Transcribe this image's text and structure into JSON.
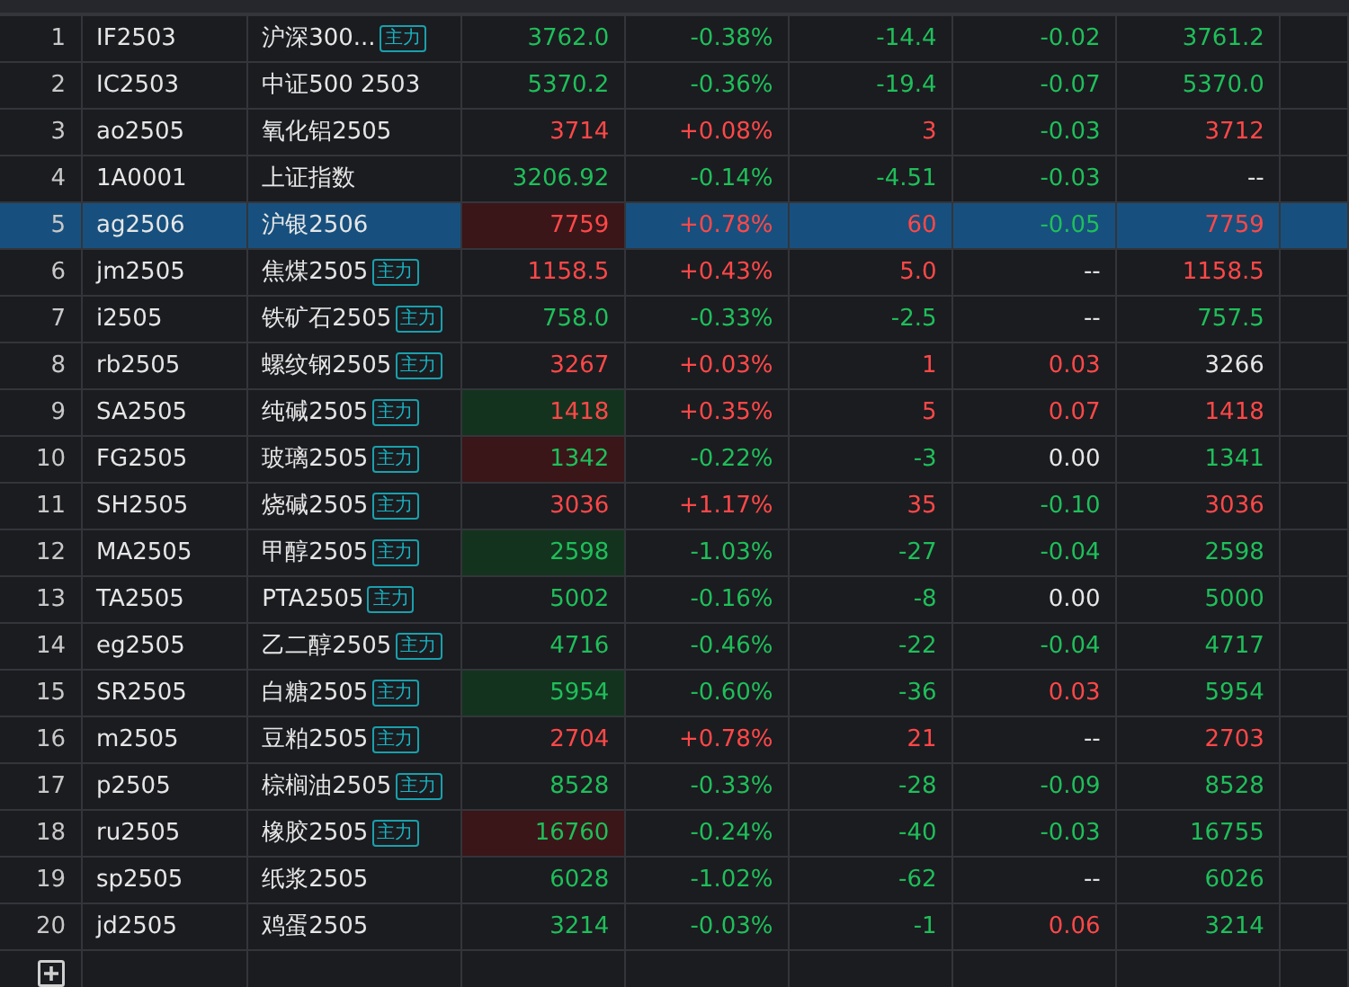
{
  "rows": [
    {
      "index": "1",
      "code": "IF2503",
      "name": "沪深300...",
      "tag": "主力",
      "selected": false,
      "cells": [
        {
          "text": "3762.0",
          "color": "#1fbf5a"
        },
        {
          "text": "-0.38%",
          "color": "#1fbf5a"
        },
        {
          "text": "-14.4",
          "color": "#1fbf5a"
        },
        {
          "text": "-0.02",
          "color": "#1fbf5a"
        },
        {
          "text": "3761.2",
          "color": "#1fbf5a"
        }
      ]
    },
    {
      "index": "2",
      "code": "IC2503",
      "name": "中证500 2503",
      "selected": false,
      "cells": [
        {
          "text": "5370.2",
          "color": "#1fbf5a"
        },
        {
          "text": "-0.36%",
          "color": "#1fbf5a"
        },
        {
          "text": "-19.4",
          "color": "#1fbf5a"
        },
        {
          "text": "-0.07",
          "color": "#1fbf5a"
        },
        {
          "text": "5370.0",
          "color": "#1fbf5a"
        }
      ]
    },
    {
      "index": "3",
      "code": "ao2505",
      "name": "氧化铝2505",
      "selected": false,
      "cells": [
        {
          "text": "3714",
          "color": "#ff4848"
        },
        {
          "text": "+0.08%",
          "color": "#ff4848"
        },
        {
          "text": "3",
          "color": "#ff4848"
        },
        {
          "text": "-0.03",
          "color": "#1fbf5a"
        },
        {
          "text": "3712",
          "color": "#ff4848"
        }
      ]
    },
    {
      "index": "4",
      "code": "1A0001",
      "name": "上证指数",
      "selected": false,
      "cells": [
        {
          "text": "3206.92",
          "color": "#1fbf5a"
        },
        {
          "text": "-0.14%",
          "color": "#1fbf5a"
        },
        {
          "text": "-4.51",
          "color": "#1fbf5a"
        },
        {
          "text": "-0.03",
          "color": "#1fbf5a"
        },
        {
          "text": "--",
          "color": "#e6e6e6"
        }
      ]
    },
    {
      "index": "5",
      "code": "ag2506",
      "name": "沪银2506",
      "selected": true,
      "highlight": {
        "color": "#3a1619"
      },
      "cells": [
        {
          "text": "7759",
          "color": "#ff4848"
        },
        {
          "text": "+0.78%",
          "color": "#ff4848"
        },
        {
          "text": "60",
          "color": "#ff4848"
        },
        {
          "text": "-0.05",
          "color": "#1fbf5a"
        },
        {
          "text": "7759",
          "color": "#ff4848"
        }
      ]
    },
    {
      "index": "6",
      "code": "jm2505",
      "name": "焦煤2505",
      "tag": "主力",
      "selected": false,
      "cells": [
        {
          "text": "1158.5",
          "color": "#ff4848"
        },
        {
          "text": "+0.43%",
          "color": "#ff4848"
        },
        {
          "text": "5.0",
          "color": "#ff4848"
        },
        {
          "text": "--",
          "color": "#e6e6e6"
        },
        {
          "text": "1158.5",
          "color": "#ff4848"
        }
      ]
    },
    {
      "index": "7",
      "code": "i2505",
      "name": "铁矿石2505",
      "tag": "主力",
      "selected": false,
      "cells": [
        {
          "text": "758.0",
          "color": "#1fbf5a"
        },
        {
          "text": "-0.33%",
          "color": "#1fbf5a"
        },
        {
          "text": "-2.5",
          "color": "#1fbf5a"
        },
        {
          "text": "--",
          "color": "#e6e6e6"
        },
        {
          "text": "757.5",
          "color": "#1fbf5a"
        }
      ]
    },
    {
      "index": "8",
      "code": "rb2505",
      "name": "螺纹钢2505",
      "tag": "主力",
      "selected": false,
      "cells": [
        {
          "text": "3267",
          "color": "#ff4848"
        },
        {
          "text": "+0.03%",
          "color": "#ff4848"
        },
        {
          "text": "1",
          "color": "#ff4848"
        },
        {
          "text": "0.03",
          "color": "#ff4848"
        },
        {
          "text": "3266",
          "color": "#e6e6e6"
        }
      ]
    },
    {
      "index": "9",
      "code": "SA2505",
      "name": "纯碱2505",
      "tag": "主力",
      "selected": false,
      "highlight": {
        "color": "#14331f"
      },
      "cells": [
        {
          "text": "1418",
          "color": "#ff4848"
        },
        {
          "text": "+0.35%",
          "color": "#ff4848"
        },
        {
          "text": "5",
          "color": "#ff4848"
        },
        {
          "text": "0.07",
          "color": "#ff4848"
        },
        {
          "text": "1418",
          "color": "#ff4848"
        }
      ]
    },
    {
      "index": "10",
      "code": "FG2505",
      "name": "玻璃2505",
      "tag": "主力",
      "selected": false,
      "highlight": {
        "color": "#3a1619"
      },
      "cells": [
        {
          "text": "1342",
          "color": "#1fbf5a"
        },
        {
          "text": "-0.22%",
          "color": "#1fbf5a"
        },
        {
          "text": "-3",
          "color": "#1fbf5a"
        },
        {
          "text": "0.00",
          "color": "#e6e6e6"
        },
        {
          "text": "1341",
          "color": "#1fbf5a"
        }
      ]
    },
    {
      "index": "11",
      "code": "SH2505",
      "name": "烧碱2505",
      "tag": "主力",
      "selected": false,
      "cells": [
        {
          "text": "3036",
          "color": "#ff4848"
        },
        {
          "text": "+1.17%",
          "color": "#ff4848"
        },
        {
          "text": "35",
          "color": "#ff4848"
        },
        {
          "text": "-0.10",
          "color": "#1fbf5a"
        },
        {
          "text": "3036",
          "color": "#ff4848"
        }
      ]
    },
    {
      "index": "12",
      "code": "MA2505",
      "name": "甲醇2505",
      "tag": "主力",
      "selected": false,
      "highlight": {
        "color": "#14331f"
      },
      "cells": [
        {
          "text": "2598",
          "color": "#1fbf5a"
        },
        {
          "text": "-1.03%",
          "color": "#1fbf5a"
        },
        {
          "text": "-27",
          "color": "#1fbf5a"
        },
        {
          "text": "-0.04",
          "color": "#1fbf5a"
        },
        {
          "text": "2598",
          "color": "#1fbf5a"
        }
      ]
    },
    {
      "index": "13",
      "code": "TA2505",
      "name": "PTA2505",
      "tag": "主力",
      "selected": false,
      "cells": [
        {
          "text": "5002",
          "color": "#1fbf5a"
        },
        {
          "text": "-0.16%",
          "color": "#1fbf5a"
        },
        {
          "text": "-8",
          "color": "#1fbf5a"
        },
        {
          "text": "0.00",
          "color": "#e6e6e6"
        },
        {
          "text": "5000",
          "color": "#1fbf5a"
        }
      ]
    },
    {
      "index": "14",
      "code": "eg2505",
      "name": "乙二醇2505",
      "tag": "主力",
      "selected": false,
      "cells": [
        {
          "text": "4716",
          "color": "#1fbf5a"
        },
        {
          "text": "-0.46%",
          "color": "#1fbf5a"
        },
        {
          "text": "-22",
          "color": "#1fbf5a"
        },
        {
          "text": "-0.04",
          "color": "#1fbf5a"
        },
        {
          "text": "4717",
          "color": "#1fbf5a"
        }
      ]
    },
    {
      "index": "15",
      "code": "SR2505",
      "name": "白糖2505",
      "tag": "主力",
      "selected": false,
      "highlight": {
        "color": "#14331f"
      },
      "cells": [
        {
          "text": "5954",
          "color": "#1fbf5a"
        },
        {
          "text": "-0.60%",
          "color": "#1fbf5a"
        },
        {
          "text": "-36",
          "color": "#1fbf5a"
        },
        {
          "text": "0.03",
          "color": "#ff4848"
        },
        {
          "text": "5954",
          "color": "#1fbf5a"
        }
      ]
    },
    {
      "index": "16",
      "code": "m2505",
      "name": "豆粕2505",
      "tag": "主力",
      "selected": false,
      "cells": [
        {
          "text": "2704",
          "color": "#ff4848"
        },
        {
          "text": "+0.78%",
          "color": "#ff4848"
        },
        {
          "text": "21",
          "color": "#ff4848"
        },
        {
          "text": "--",
          "color": "#e6e6e6"
        },
        {
          "text": "2703",
          "color": "#ff4848"
        }
      ]
    },
    {
      "index": "17",
      "code": "p2505",
      "name": "棕榈油2505",
      "tag": "主力",
      "selected": false,
      "cells": [
        {
          "text": "8528",
          "color": "#1fbf5a"
        },
        {
          "text": "-0.33%",
          "color": "#1fbf5a"
        },
        {
          "text": "-28",
          "color": "#1fbf5a"
        },
        {
          "text": "-0.09",
          "color": "#1fbf5a"
        },
        {
          "text": "8528",
          "color": "#1fbf5a"
        }
      ]
    },
    {
      "index": "18",
      "code": "ru2505",
      "name": "橡胶2505",
      "tag": "主力",
      "selected": false,
      "highlight": {
        "color": "#3a1619"
      },
      "cells": [
        {
          "text": "16760",
          "color": "#1fbf5a"
        },
        {
          "text": "-0.24%",
          "color": "#1fbf5a"
        },
        {
          "text": "-40",
          "color": "#1fbf5a"
        },
        {
          "text": "-0.03",
          "color": "#1fbf5a"
        },
        {
          "text": "16755",
          "color": "#1fbf5a"
        }
      ]
    },
    {
      "index": "19",
      "code": "sp2505",
      "name": "纸浆2505",
      "selected": false,
      "cells": [
        {
          "text": "6028",
          "color": "#1fbf5a"
        },
        {
          "text": "-1.02%",
          "color": "#1fbf5a"
        },
        {
          "text": "-62",
          "color": "#1fbf5a"
        },
        {
          "text": "--",
          "color": "#e6e6e6"
        },
        {
          "text": "6026",
          "color": "#1fbf5a"
        }
      ]
    },
    {
      "index": "20",
      "code": "jd2505",
      "name": "鸡蛋2505",
      "selected": false,
      "cells": [
        {
          "text": "3214",
          "color": "#1fbf5a"
        },
        {
          "text": "-0.03%",
          "color": "#1fbf5a"
        },
        {
          "text": "-1",
          "color": "#1fbf5a"
        },
        {
          "text": "0.06",
          "color": "#ff4848"
        },
        {
          "text": "3214",
          "color": "#1fbf5a"
        }
      ]
    }
  ]
}
